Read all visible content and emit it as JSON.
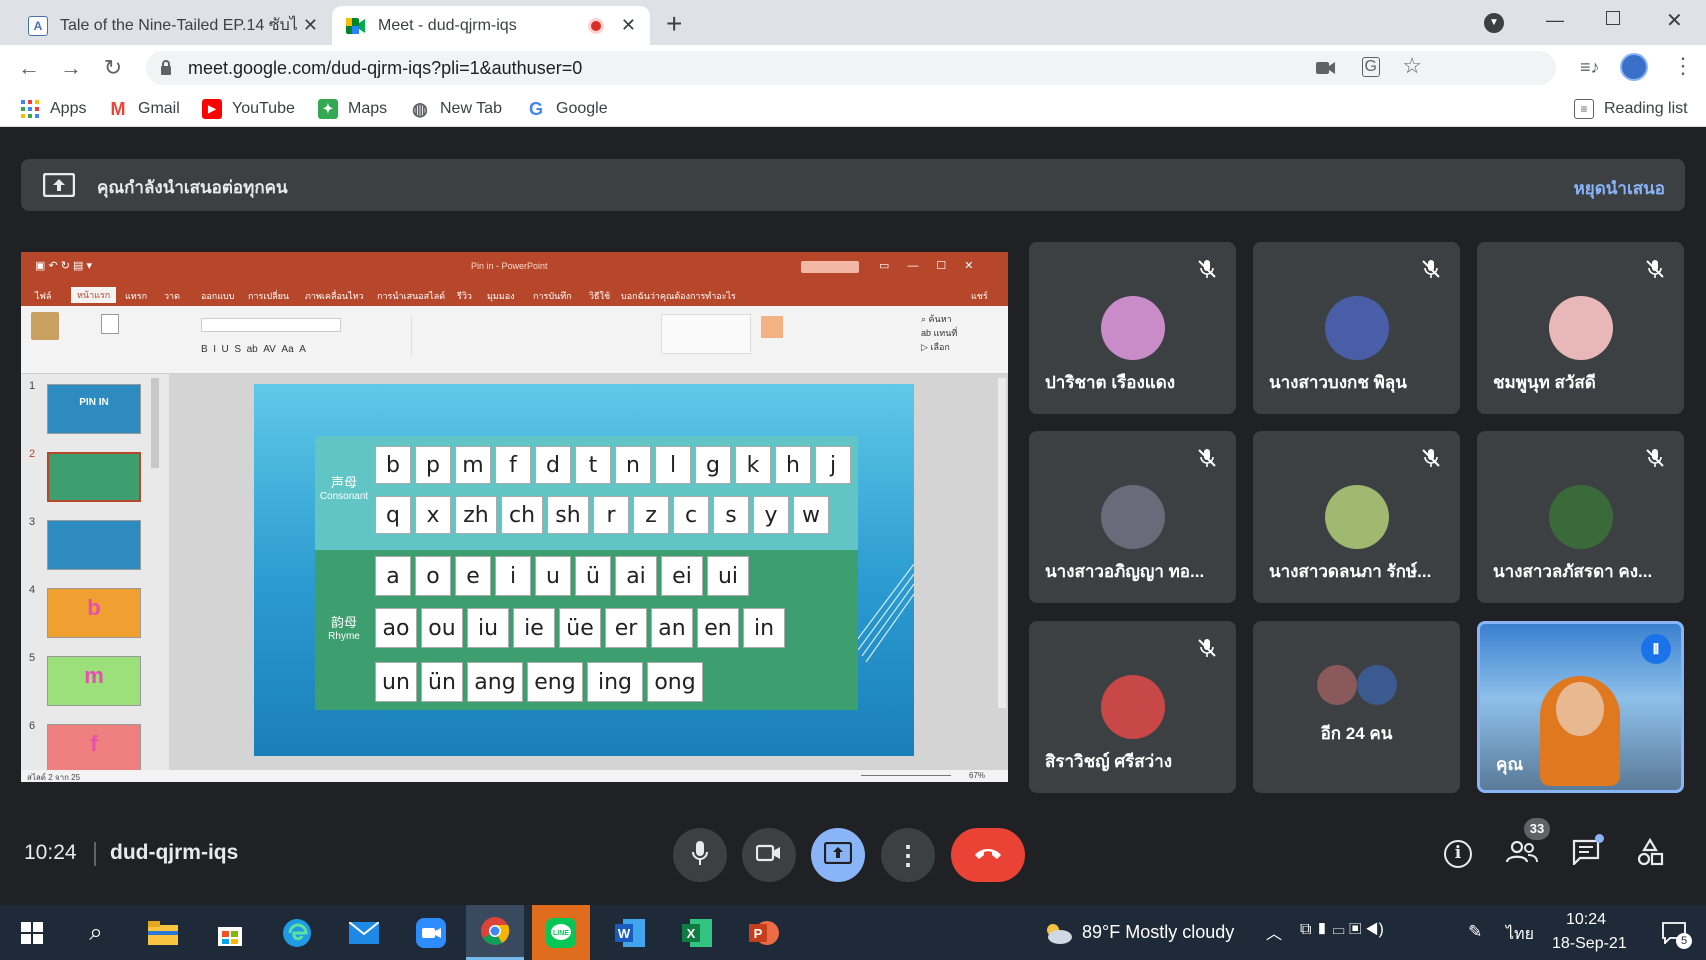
{
  "browser": {
    "tabs": [
      {
        "title": "Tale of the Nine-Tailed EP.14 ซับไ",
        "favicon_letter": "A",
        "active": false
      },
      {
        "title": "Meet - dud-qjrm-iqs",
        "favicon_letter": "",
        "active": true,
        "recording": true
      }
    ],
    "url": "meet.google.com/dud-qjrm-iqs?pli=1&authuser=0",
    "bookmarks": [
      {
        "label": "Apps",
        "icon": "apps-grid-icon"
      },
      {
        "label": "Gmail",
        "icon": "gmail-icon"
      },
      {
        "label": "YouTube",
        "icon": "youtube-icon"
      },
      {
        "label": "Maps",
        "icon": "maps-icon"
      },
      {
        "label": "New Tab",
        "icon": "globe-icon"
      },
      {
        "label": "Google",
        "icon": "google-icon"
      }
    ],
    "reading_list": "Reading list"
  },
  "meet": {
    "presenting_banner": "คุณกำลังนำเสนอต่อทุกคน",
    "stop_presenting": "หยุดนำเสนอ",
    "presentation": {
      "window_title": "Pin in  -  PowerPoint",
      "share_button": "แชร์",
      "menu_tabs": [
        "ไฟล์",
        "หน้าแรก",
        "แทรก",
        "วาด",
        "ออกแบบ",
        "การเปลี่ยน",
        "ภาพเคลื่อนไหว",
        "การนำเสนอสไลด์",
        "รีวิว",
        "มุมมอง",
        "การบันทึก",
        "วิธีใช้",
        "บอกฉันว่าคุณต้องการทำอะไร"
      ],
      "thumbnails": [
        {
          "num": "1",
          "label": "PIN IN",
          "bg": "#2d8bc0"
        },
        {
          "num": "2",
          "label": "",
          "bg": "#3d9e6f"
        },
        {
          "num": "3",
          "label": "",
          "bg": "#2d8bc0"
        },
        {
          "num": "4",
          "label": "b",
          "bg": "#f0a030"
        },
        {
          "num": "5",
          "label": "m",
          "bg": "#9be07a"
        },
        {
          "num": "6",
          "label": "f",
          "bg": "#f08080"
        }
      ],
      "status_left": "สไลด์ 2 จาก 25",
      "zoom": "67%",
      "slide": {
        "consonant_label_cn": "声母",
        "consonant_label": "Consonant",
        "rhyme_label_cn": "韵母",
        "rhyme_label": "Rhyme",
        "consonant_row1": [
          "b",
          "p",
          "m",
          "f",
          "d",
          "t",
          "n",
          "l",
          "g",
          "k",
          "h",
          "j"
        ],
        "consonant_row2": [
          "q",
          "x",
          "zh",
          "ch",
          "sh",
          "r",
          "z",
          "c",
          "s",
          "y",
          "w"
        ],
        "rhyme_row1": [
          "a",
          "o",
          "e",
          "i",
          "u",
          "ü",
          "ai",
          "ei",
          "ui"
        ],
        "rhyme_row2": [
          "ao",
          "ou",
          "iu",
          "ie",
          "üe",
          "er",
          "an",
          "en",
          "in"
        ],
        "rhyme_row3": [
          "un",
          "ün",
          "ang",
          "eng",
          "ing",
          "ong"
        ]
      }
    },
    "participants": [
      {
        "name": "ปาริชาต เรืองแดง",
        "muted": true,
        "avatar_color": "#c98cc9"
      },
      {
        "name": "นางสาวบงกช พิลุน",
        "muted": true,
        "avatar_color": "#4a5ea8"
      },
      {
        "name": "ชมพูนุท สวัสดี",
        "muted": true,
        "avatar_color": "#e8b8b8"
      },
      {
        "name": "นางสาวอภิญญา ทอ...",
        "muted": true,
        "avatar_color": "#6a6a7a"
      },
      {
        "name": "นางสาวดลนภา รักษ์...",
        "muted": true,
        "avatar_color": "#a0b870"
      },
      {
        "name": "นางสาวลภัสรดา คง...",
        "muted": true,
        "avatar_color": "#3a6a3a"
      },
      {
        "name": "สิราวิชญ์ ศรีสว่าง",
        "muted": true,
        "avatar_color": "#c84848"
      },
      {
        "name": "อีก 24 คน",
        "muted": false,
        "avatar_color": "#8a5a5a"
      },
      {
        "name": "คุณ",
        "muted": false,
        "speaking": true,
        "avatar_color": "#e07820"
      }
    ],
    "clock": "10:24",
    "meeting_code": "dud-qjrm-iqs",
    "people_count": "33"
  },
  "taskbar": {
    "weather": "89°F  Mostly cloudy",
    "language": "ไทย",
    "time": "10:24",
    "date": "18-Sep-21",
    "notifications": "5"
  }
}
